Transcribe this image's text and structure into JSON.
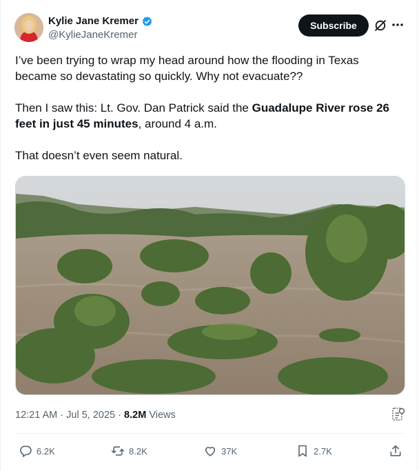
{
  "author": {
    "name": "Kylie Jane Kremer",
    "handle": "@KylieJaneKremer",
    "verified_icon": "verified-badge-icon",
    "verified_color": "#1d9bf0"
  },
  "header": {
    "subscribe_label": "Subscribe",
    "grok_icon": "grok-icon",
    "more_icon": "more-icon"
  },
  "post": {
    "p1": "I’ve been trying to wrap my head around how the flooding in Texas became so devastating so quickly. Why not evacuate??",
    "p2_start": "Then I saw this: Lt. Gov. Dan Patrick said the ",
    "p2_bold": "Guadalupe River rose 26 feet in just 45 minutes",
    "p2_end": ", around 4 a.m.",
    "p3": "That doesn’t even seem natural."
  },
  "meta": {
    "time": "12:21 AM",
    "separator": "·",
    "date": "Jul 5, 2025",
    "views_count": "8.2M",
    "views_label": "Views"
  },
  "actions": {
    "replies": "6.2K",
    "reposts": "8.2K",
    "likes": "37K",
    "bookmarks": "2.7K"
  },
  "colors": {
    "text": "#0f1419",
    "secondary": "#536471",
    "accent": "#1d9bf0"
  }
}
